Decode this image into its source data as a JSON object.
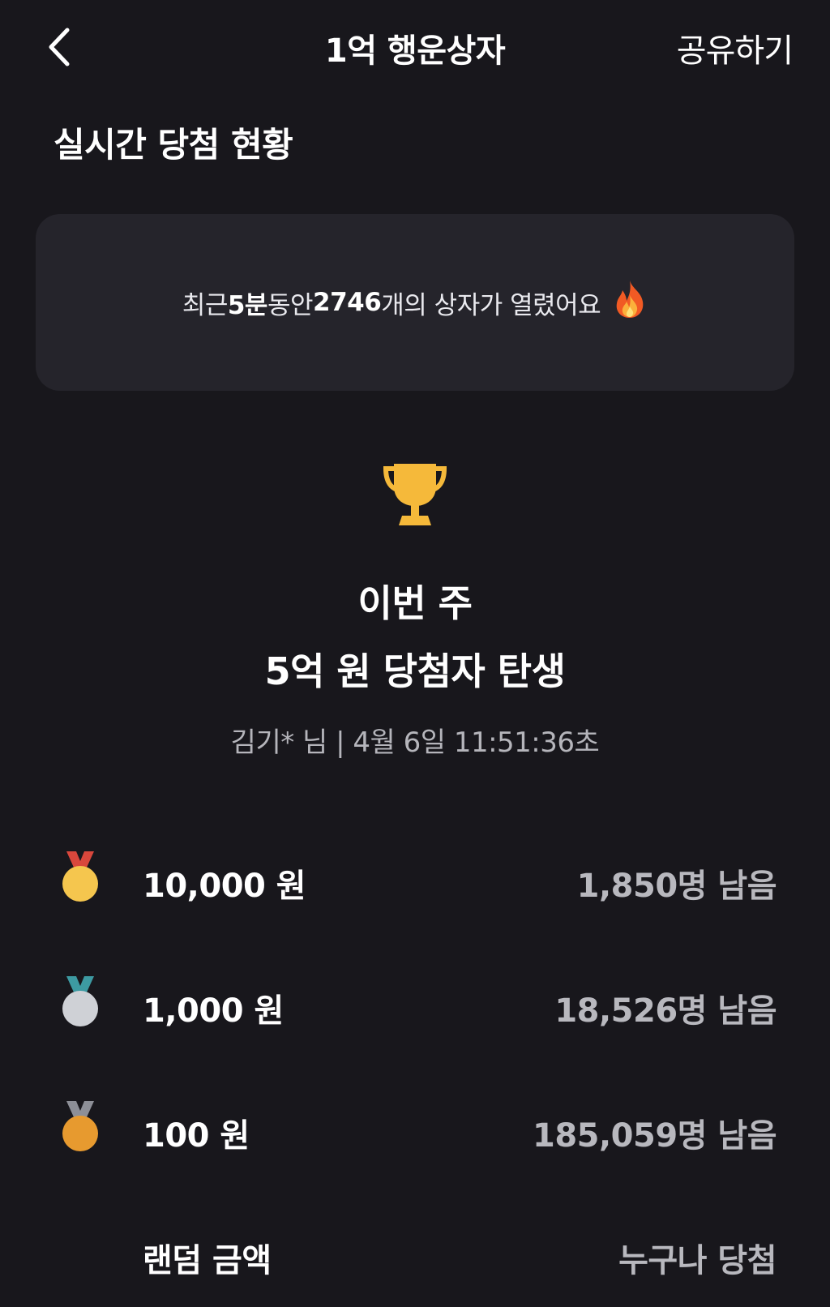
{
  "header": {
    "back_icon": "chevron-left-icon",
    "title": "1억 행운상자",
    "share_label": "공유하기"
  },
  "section": {
    "title": "실시간 당첨 현황"
  },
  "stat_card": {
    "prefix": "최근 ",
    "minutes": "5분",
    "middle": " 동안 ",
    "count": "2746",
    "suffix": "개의 상자가 열렸어요",
    "icon": "fire-icon"
  },
  "winner": {
    "icon": "trophy-icon",
    "line1": "이번 주",
    "line2": "5억 원 당첨자 탄생",
    "meta": "김기* 님 | 4월 6일 11:51:36초"
  },
  "prizes": [
    {
      "medal": "gold-medal-icon",
      "amount": "10,000 원",
      "remaining": "1,850명 남음"
    },
    {
      "medal": "silver-medal-icon",
      "amount": "1,000 원",
      "remaining": "18,526명 남음"
    },
    {
      "medal": "bronze-medal-icon",
      "amount": "100 원",
      "remaining": "185,059명 남음"
    },
    {
      "medal": "",
      "amount": "랜덤 금액",
      "remaining": "누구나 당첨"
    }
  ],
  "colors": {
    "background": "#18171c",
    "card": "#25242b",
    "trophy": "#f5b93a",
    "gold": "#f5c64e",
    "silver": "#cfd1d6",
    "bronze": "#e79a2f",
    "muted_text": "#b8b8be"
  }
}
